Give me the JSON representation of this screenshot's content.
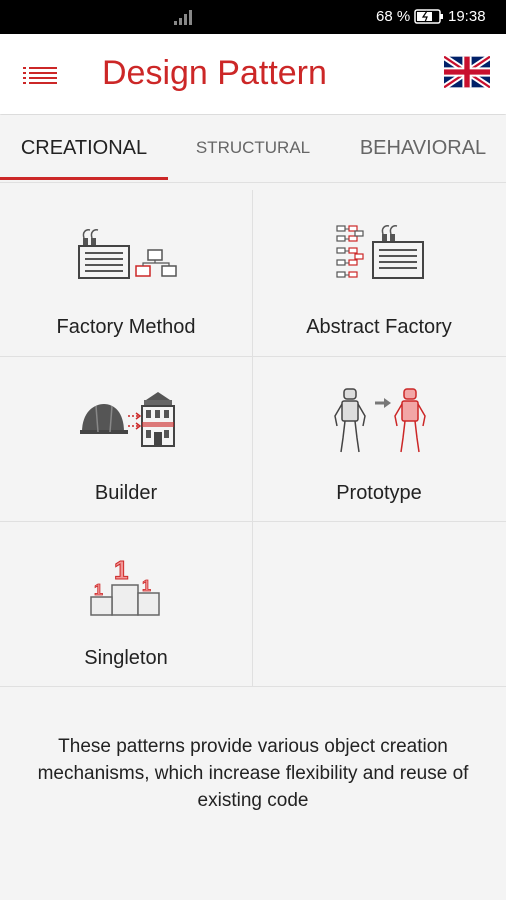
{
  "status_bar": {
    "battery_percent": "68 %",
    "time": "19:38",
    "icons": [
      "signal-icon",
      "battery-icon"
    ]
  },
  "app_bar": {
    "title": "Design Pattern",
    "menu_icon": "menu-list-icon",
    "language_icon": "uk-flag-icon"
  },
  "tabs": [
    {
      "label": "CREATIONAL",
      "selected": true
    },
    {
      "label": "STRUCTURAL",
      "selected": false
    },
    {
      "label": "BEHAVIORAL",
      "selected": false
    }
  ],
  "patterns": [
    {
      "label": "Factory Method",
      "icon": "factory-method-icon"
    },
    {
      "label": "Abstract Factory",
      "icon": "abstract-factory-icon"
    },
    {
      "label": "Builder",
      "icon": "builder-icon"
    },
    {
      "label": "Prototype",
      "icon": "prototype-icon"
    },
    {
      "label": "Singleton",
      "icon": "singleton-icon"
    }
  ],
  "description": "These patterns provide various object creation mechanisms, which increase flexibility and reuse of existing code",
  "colors": {
    "accent": "#cc2727",
    "background": "#f4f4f4",
    "status_bar": "#000000"
  }
}
